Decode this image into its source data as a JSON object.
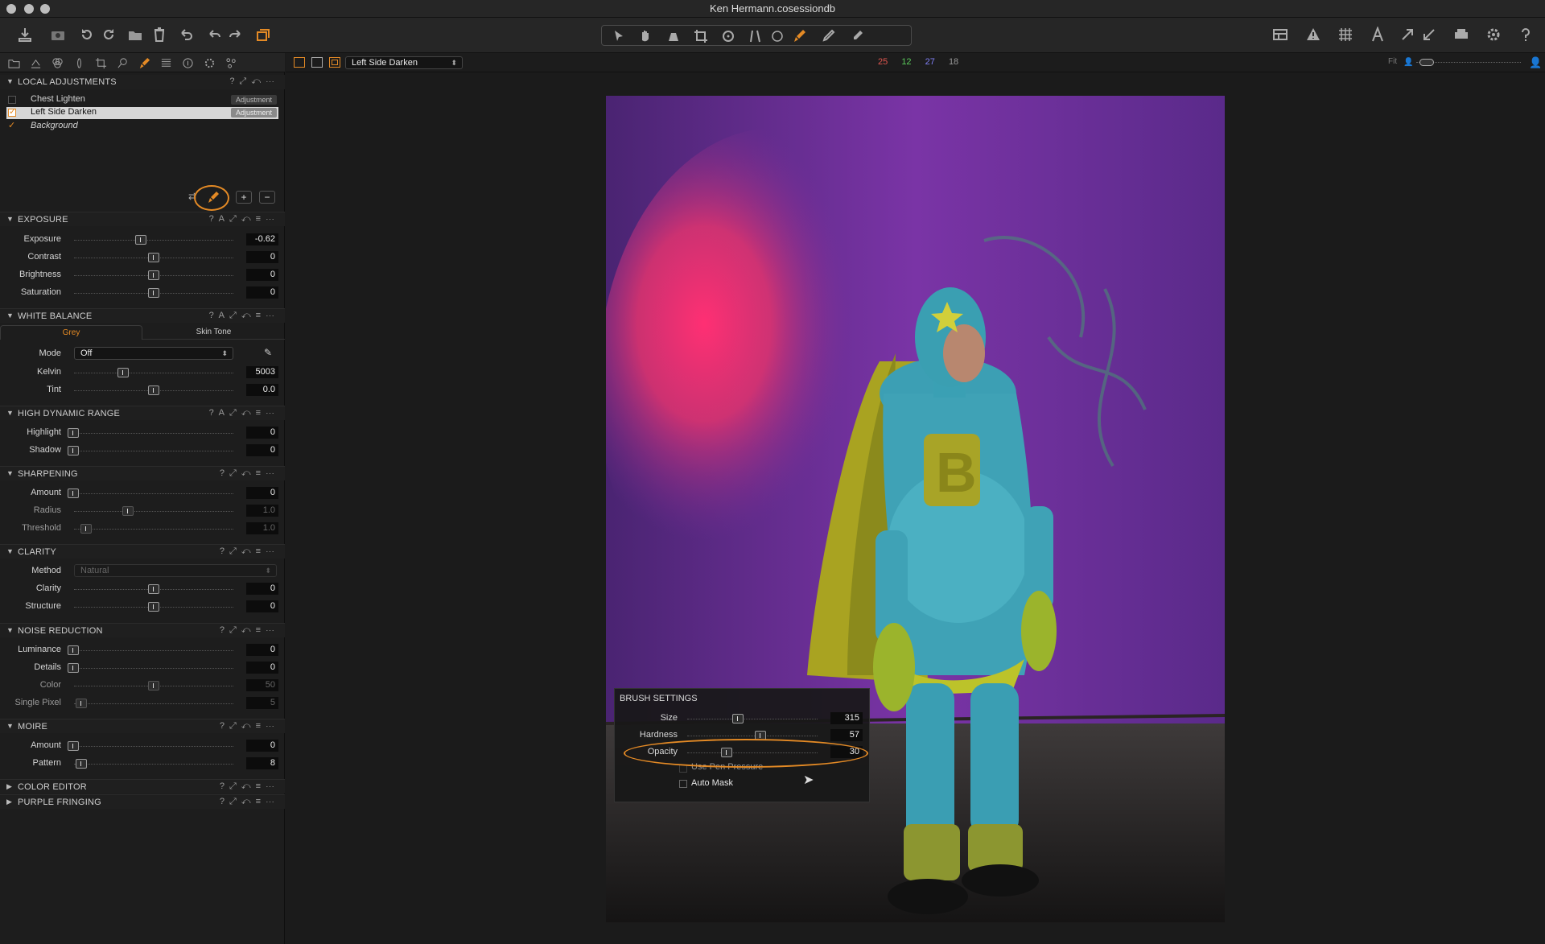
{
  "window": {
    "title": "Ken Hermann.cosessiondb"
  },
  "viewer": {
    "variant_select": "Left Side Darken",
    "counts": [
      {
        "value": "25",
        "color": "#e2564f"
      },
      {
        "value": "12",
        "color": "#59c95a"
      },
      {
        "value": "27",
        "color": "#7f7ff5"
      },
      {
        "value": "18",
        "color": "#9a9a9a"
      }
    ],
    "fit_label": "Fit"
  },
  "local_adjustments": {
    "title": "LOCAL ADJUSTMENTS",
    "items": [
      {
        "name": "Chest Lighten",
        "badge": "Adjustment",
        "checked": false
      },
      {
        "name": "Left Side Darken",
        "badge": "Adjustment",
        "checked": true
      },
      {
        "name": "Background",
        "badge": "",
        "checked": true
      }
    ]
  },
  "exposure": {
    "title": "EXPOSURE",
    "rows": [
      {
        "label": "Exposure",
        "value": "-0.62"
      },
      {
        "label": "Contrast",
        "value": "0"
      },
      {
        "label": "Brightness",
        "value": "0"
      },
      {
        "label": "Saturation",
        "value": "0"
      }
    ]
  },
  "white_balance": {
    "title": "WHITE BALANCE",
    "tab_grey": "Grey",
    "tab_skin": "Skin Tone",
    "mode_label": "Mode",
    "mode_value": "Off",
    "rows": [
      {
        "label": "Kelvin",
        "value": "5003"
      },
      {
        "label": "Tint",
        "value": "0.0"
      }
    ]
  },
  "hdr": {
    "title": "HIGH DYNAMIC RANGE",
    "rows": [
      {
        "label": "Highlight",
        "value": "0"
      },
      {
        "label": "Shadow",
        "value": "0"
      }
    ]
  },
  "sharpening": {
    "title": "SHARPENING",
    "rows": [
      {
        "label": "Amount",
        "value": "0"
      },
      {
        "label": "Radius",
        "value": "1.0"
      },
      {
        "label": "Threshold",
        "value": "1.0"
      }
    ]
  },
  "clarity": {
    "title": "CLARITY",
    "method_label": "Method",
    "method_value": "Natural",
    "rows": [
      {
        "label": "Clarity",
        "value": "0"
      },
      {
        "label": "Structure",
        "value": "0"
      }
    ]
  },
  "noise": {
    "title": "NOISE REDUCTION",
    "rows": [
      {
        "label": "Luminance",
        "value": "0"
      },
      {
        "label": "Details",
        "value": "0"
      },
      {
        "label": "Color",
        "value": "50"
      },
      {
        "label": "Single Pixel",
        "value": "5"
      }
    ]
  },
  "moire": {
    "title": "MOIRE",
    "rows": [
      {
        "label": "Amount",
        "value": "0"
      },
      {
        "label": "Pattern",
        "value": "8"
      }
    ]
  },
  "color_editor": {
    "title": "COLOR EDITOR"
  },
  "purple_fringing": {
    "title": "PURPLE FRINGING"
  },
  "brush_settings": {
    "title": "BRUSH SETTINGS",
    "rows": [
      {
        "label": "Size",
        "value": "315"
      },
      {
        "label": "Hardness",
        "value": "57"
      },
      {
        "label": "Opacity",
        "value": "30"
      }
    ],
    "use_pen_pressure": "Use Pen Pressure",
    "auto_mask": "Auto Mask"
  },
  "colors": {
    "accent": "#e48a25",
    "panel": "#1d1d1d",
    "wall": "#5d2b8e",
    "suit": "#3fa2b6"
  }
}
